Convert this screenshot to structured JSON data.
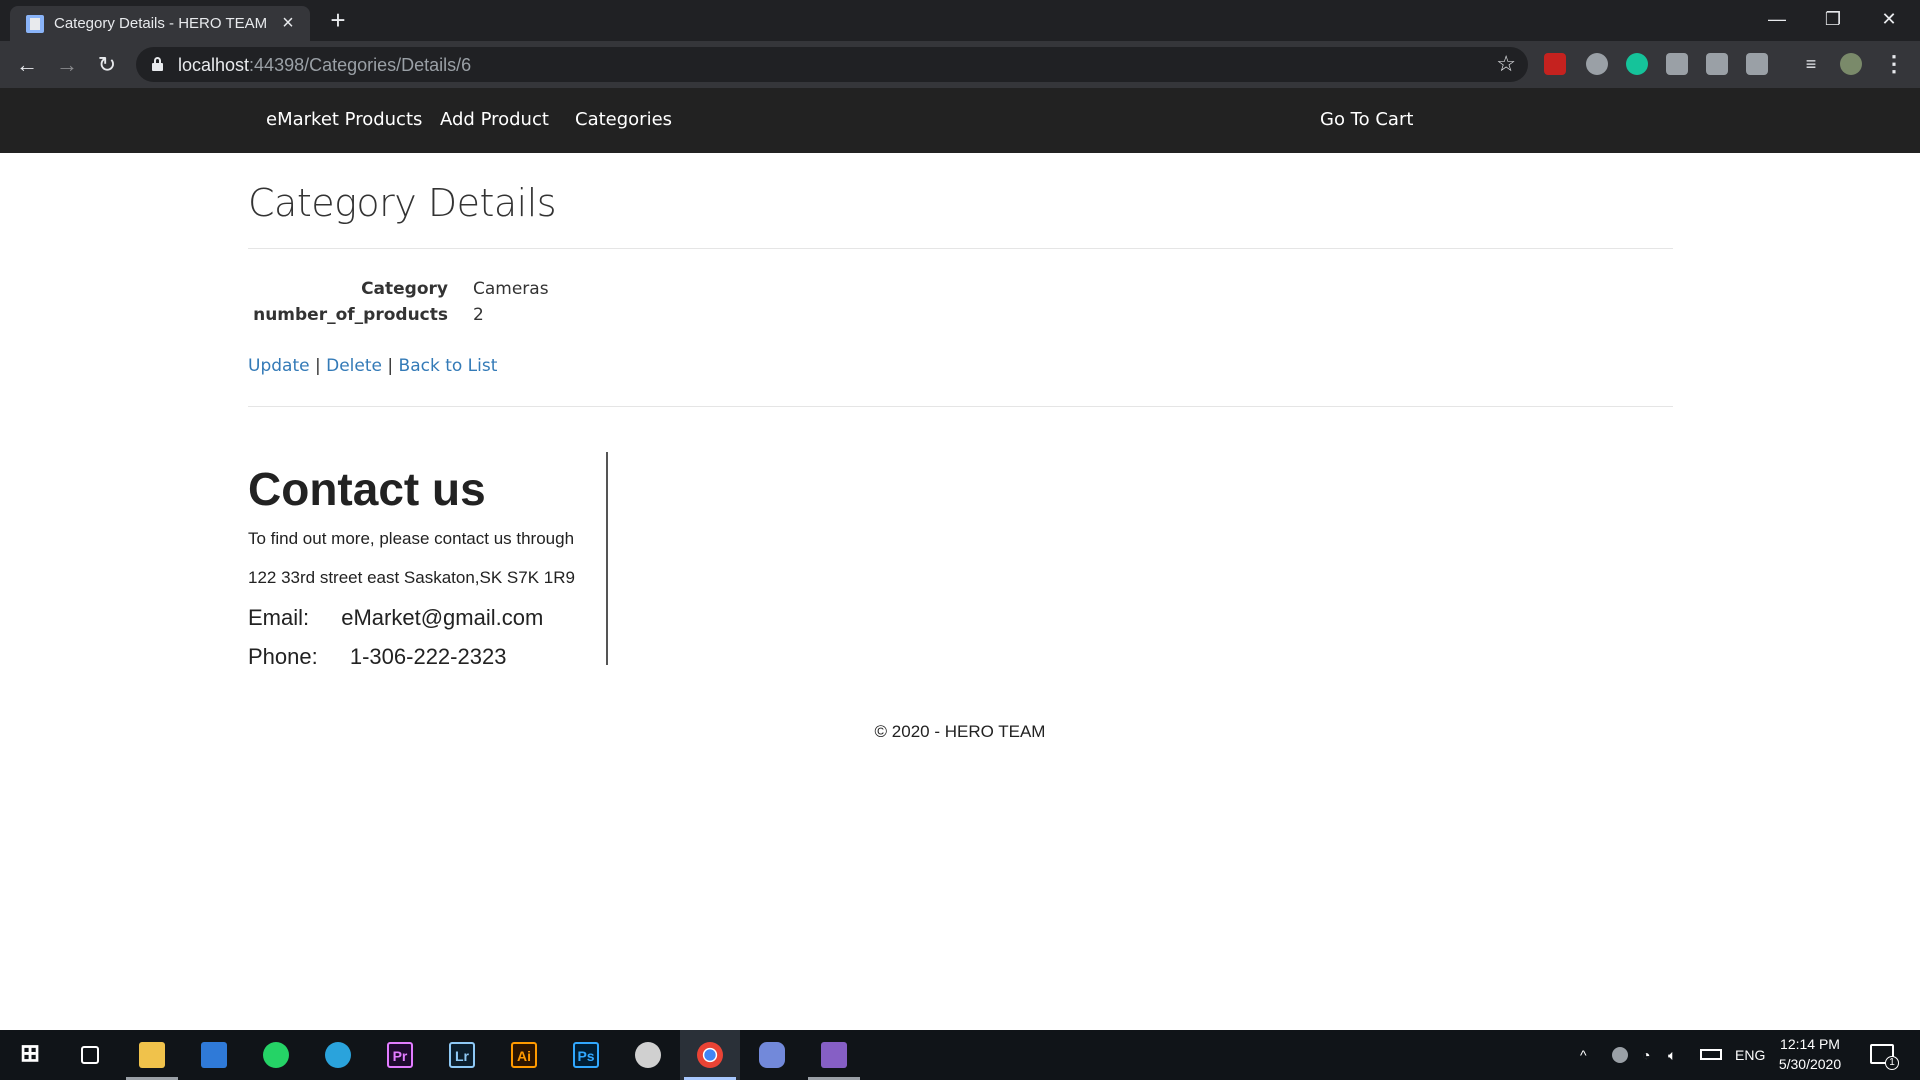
{
  "browser": {
    "tab_title": "Category Details - HERO TEAM",
    "url_host": "localhost",
    "url_path": ":44398/Categories/Details/6"
  },
  "nav": {
    "brand": "eMarket Products",
    "add_product": "Add Product",
    "categories": "Categories",
    "cart": "Go To Cart"
  },
  "page": {
    "title": "Category Details",
    "fields": [
      {
        "label": "Category",
        "value": "Cameras"
      },
      {
        "label": "number_of_products",
        "value": "2"
      }
    ],
    "actions": {
      "update": "Update",
      "delete": "Delete",
      "back": "Back to List",
      "separator": "|"
    }
  },
  "contact": {
    "heading": "Contact us",
    "intro": "To find out more, please contact us through",
    "address": "122 33rd street east Saskaton,SK S7K 1R9",
    "email_label": "Email:",
    "email": "eMarket@gmail.com",
    "phone_label": "Phone:",
    "phone": "1-306-222-2323"
  },
  "footer": "© 2020 - HERO TEAM",
  "taskbar": {
    "apps": [
      "windows-start",
      "task-view",
      "file-explorer",
      "mail",
      "whatsapp",
      "telegram",
      "premiere-pro",
      "lightroom",
      "illustrator",
      "photoshop",
      "unity",
      "chrome",
      "discord",
      "visual-studio"
    ],
    "premiere_label": "Pr",
    "lightroom_label": "Lr",
    "illustrator_label": "Ai",
    "photoshop_label": "Ps",
    "language": "ENG",
    "time": "12:14 PM",
    "date": "5/30/2020",
    "notification_count": "1"
  }
}
